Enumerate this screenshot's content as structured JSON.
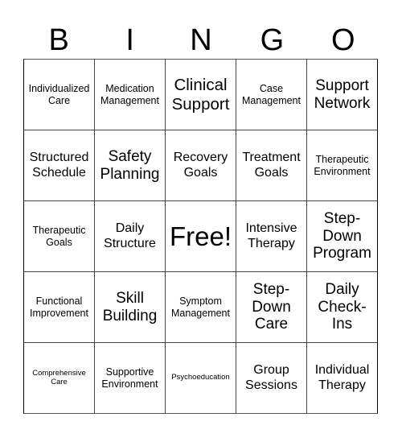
{
  "header": {
    "letters": [
      "B",
      "I",
      "N",
      "G",
      "O"
    ]
  },
  "grid": {
    "rows": [
      [
        {
          "text": "Individualized Care",
          "size": "sm"
        },
        {
          "text": "Medication Management",
          "size": "sm"
        },
        {
          "text": "Clinical Support",
          "size": "xl"
        },
        {
          "text": "Case Management",
          "size": "sm"
        },
        {
          "text": "Support Network",
          "size": "lg"
        }
      ],
      [
        {
          "text": "Structured Schedule",
          "size": "md"
        },
        {
          "text": "Safety Planning",
          "size": "lg"
        },
        {
          "text": "Recovery Goals",
          "size": "md"
        },
        {
          "text": "Treatment Goals",
          "size": "md"
        },
        {
          "text": "Therapeutic Environment",
          "size": "sm"
        }
      ],
      [
        {
          "text": "Therapeutic Goals",
          "size": "sm"
        },
        {
          "text": "Daily Structure",
          "size": "md"
        },
        {
          "text": "Free!",
          "size": "free"
        },
        {
          "text": "Intensive Therapy",
          "size": "md"
        },
        {
          "text": "Step-Down Program",
          "size": "lg"
        }
      ],
      [
        {
          "text": "Functional Improvement",
          "size": "sm"
        },
        {
          "text": "Skill Building",
          "size": "lg"
        },
        {
          "text": "Symptom Management",
          "size": "sm"
        },
        {
          "text": "Step-Down Care",
          "size": "lg"
        },
        {
          "text": "Daily Check-Ins",
          "size": "lg"
        }
      ],
      [
        {
          "text": "Comprehensive Care",
          "size": "xs"
        },
        {
          "text": "Supportive Environment",
          "size": "sm"
        },
        {
          "text": "Psychoeducation",
          "size": "xs"
        },
        {
          "text": "Group Sessions",
          "size": "md"
        },
        {
          "text": "Individual Therapy",
          "size": "md"
        }
      ]
    ]
  }
}
